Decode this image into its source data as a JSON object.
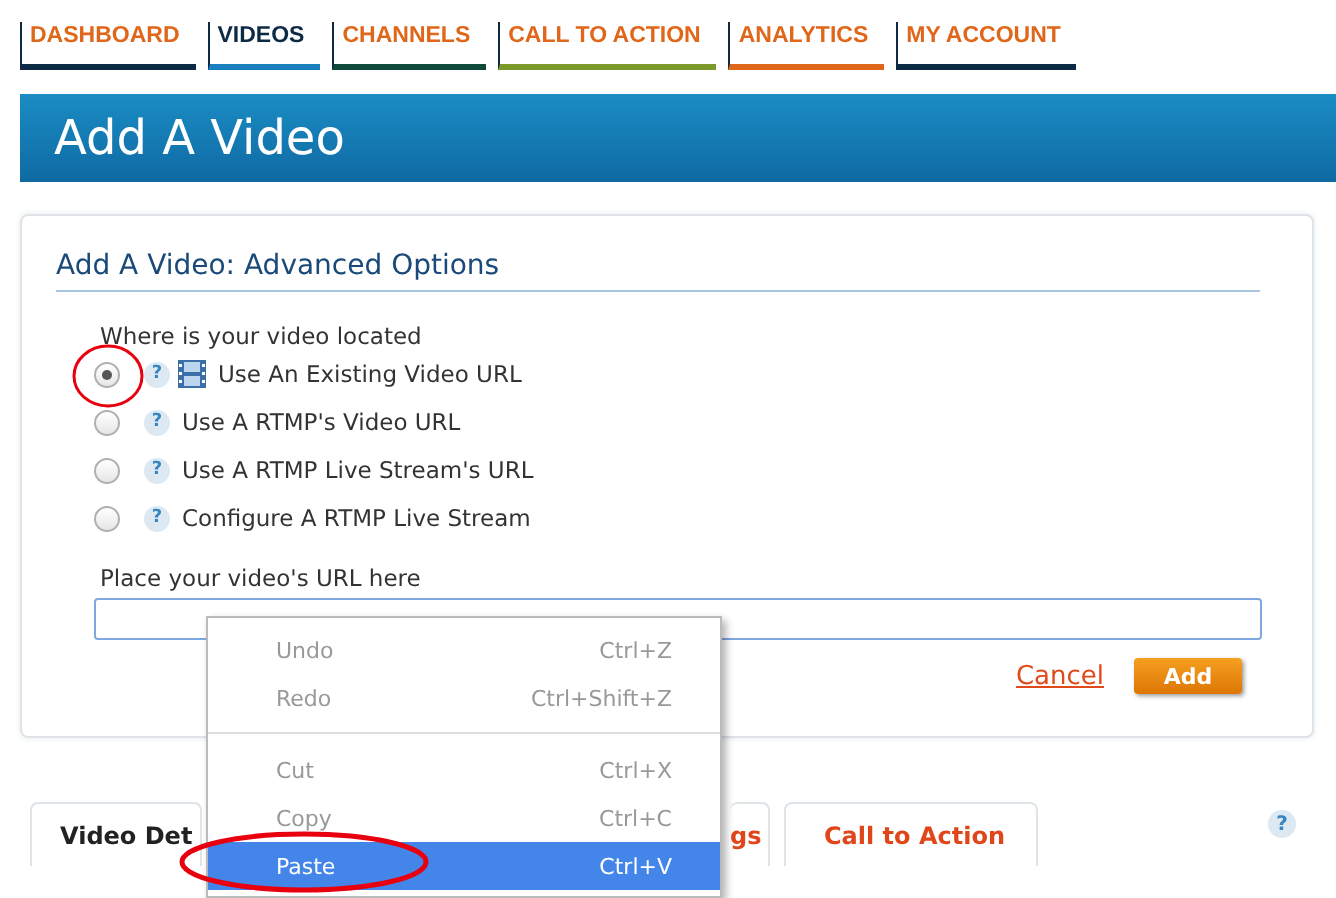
{
  "nav": [
    {
      "label": "DASHBOARD",
      "selected": false,
      "color": "#0d2a45"
    },
    {
      "label": "VIDEOS",
      "selected": true,
      "color": "#1a7fbf"
    },
    {
      "label": "CHANNELS",
      "selected": false,
      "color": "#0e4a3a"
    },
    {
      "label": "CALL TO ACTION",
      "selected": false,
      "color": "#7c9a2a"
    },
    {
      "label": "ANALYTICS",
      "selected": false,
      "color": "#e0661a"
    },
    {
      "label": "MY ACCOUNT",
      "selected": false,
      "color": "#0d2a45"
    }
  ],
  "page_title": "Add A Video",
  "panel": {
    "title": "Add A Video: Advanced Options",
    "location_label": "Where is your video located",
    "options": [
      {
        "label": "Use An Existing Video URL",
        "selected": true,
        "kind": "film"
      },
      {
        "label": "Use A RTMP's Video URL",
        "selected": false,
        "kind": "plain"
      },
      {
        "label": "Use A RTMP Live Stream's URL",
        "selected": false,
        "kind": "plain"
      },
      {
        "label": "Configure A RTMP Live Stream",
        "selected": false,
        "kind": "plain"
      }
    ],
    "help_mark": "?",
    "url_label": "Place your video's URL here",
    "cancel": "Cancel",
    "add": "Add"
  },
  "bottom_tabs": [
    {
      "label": "Video Det",
      "selected": true
    },
    {
      "label": "gs",
      "selected": false
    },
    {
      "label": "Call to Action",
      "selected": false
    }
  ],
  "bottom_help": "?",
  "context_menu": {
    "groups": [
      [
        {
          "label": "Undo",
          "shortcut": "Ctrl+Z",
          "disabled": true,
          "selected": false
        },
        {
          "label": "Redo",
          "shortcut": "Ctrl+Shift+Z",
          "disabled": true,
          "selected": false
        }
      ],
      [
        {
          "label": "Cut",
          "shortcut": "Ctrl+X",
          "disabled": true,
          "selected": false
        },
        {
          "label": "Copy",
          "shortcut": "Ctrl+C",
          "disabled": true,
          "selected": false
        },
        {
          "label": "Paste",
          "shortcut": "Ctrl+V",
          "disabled": false,
          "selected": true
        }
      ]
    ]
  }
}
